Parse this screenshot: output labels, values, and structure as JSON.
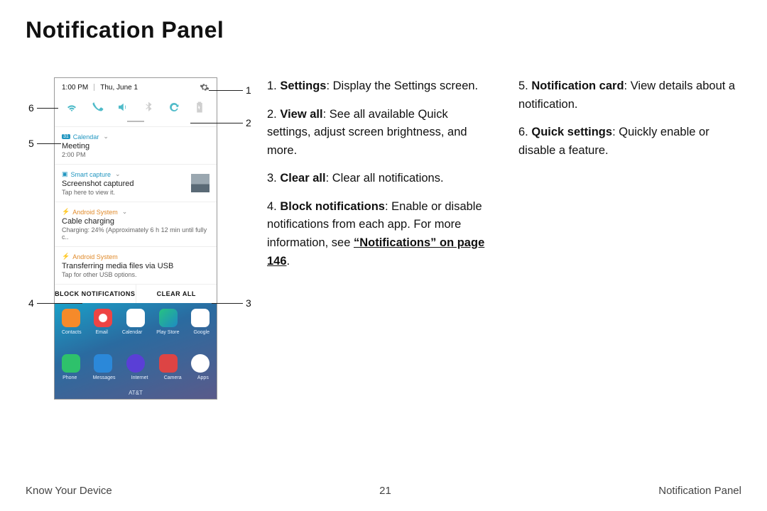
{
  "page_title": "Notification Panel",
  "footer": {
    "left": "Know Your Device",
    "center": "21",
    "right": "Notification Panel"
  },
  "phone": {
    "status": {
      "time": "1:00 PM",
      "date": "Thu, June 1"
    },
    "carrier": "AT&T",
    "buttons": {
      "block": "BLOCK NOTIFICATIONS",
      "clear": "CLEAR ALL"
    },
    "notifs": {
      "calendar": {
        "app": "Calendar",
        "title": "Meeting",
        "sub": "2:00 PM"
      },
      "smartcapture": {
        "app": "Smart capture",
        "title": "Screenshot captured",
        "sub": "Tap here to view it."
      },
      "android1": {
        "app": "Android System",
        "title": "Cable charging",
        "sub": "Charging: 24% (Approximately 6 h 12 min until fully c.."
      },
      "android2": {
        "app": "Android System",
        "title": "Transferring media files via USB",
        "sub": "Tap for other USB options."
      }
    },
    "home_labels": {
      "r1": [
        "Contacts",
        "Email",
        "Calendar",
        "Play Store",
        "Google"
      ],
      "r2": [
        "Phone",
        "Messages",
        "Internet",
        "Camera",
        "Apps"
      ]
    }
  },
  "callouts": {
    "c1": "1",
    "c2": "2",
    "c3": "3",
    "c4": "4",
    "c5": "5",
    "c6": "6"
  },
  "list": {
    "i1": {
      "b": "Settings",
      "t": ": Display the Settings screen."
    },
    "i2": {
      "b": "View all",
      "t": ": See all available Quick settings, adjust screen brightness, and more."
    },
    "i3": {
      "b": "Clear all",
      "t": ": Clear all notifications."
    },
    "i4": {
      "b": "Block notifications",
      "t": ": Enable or disable notifications from each app. For more information, see ",
      "link": "“Notifications” on page 146",
      "t2": "."
    },
    "i5": {
      "b": "Notification card",
      "t": ": View details about a notification."
    },
    "i6": {
      "b": "Quick settings",
      "t": ": Quickly enable or disable a feature."
    }
  }
}
